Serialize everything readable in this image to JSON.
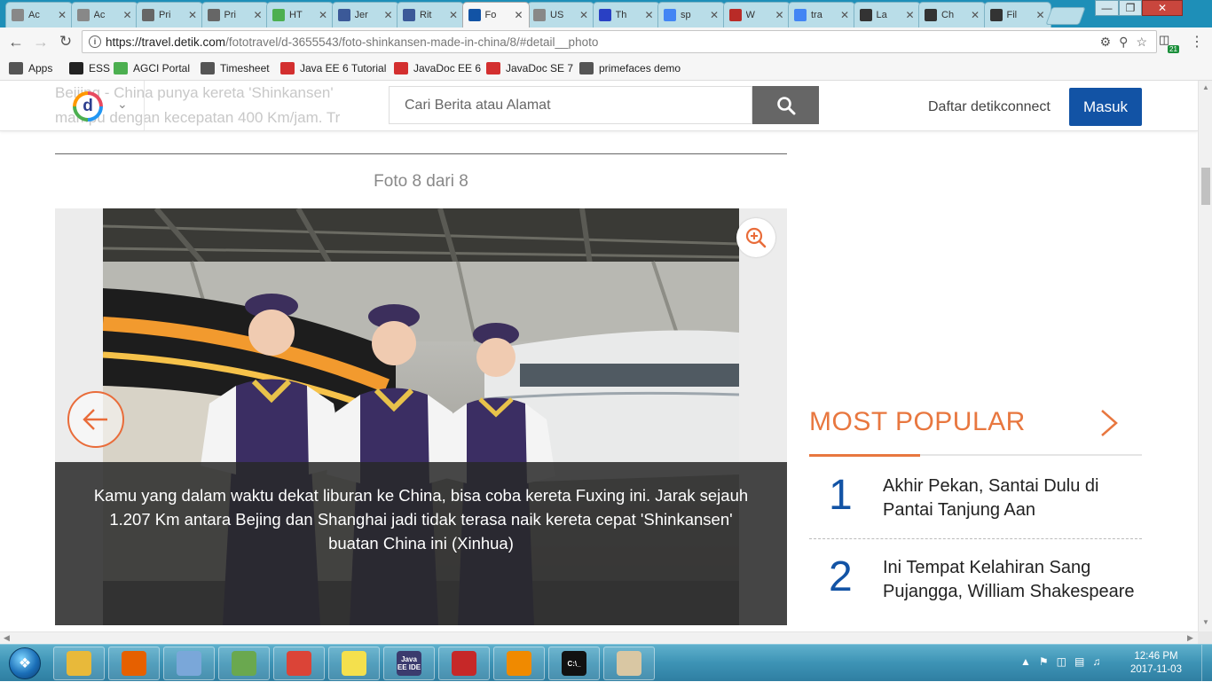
{
  "browser": {
    "tabs": [
      {
        "label": "Ac",
        "icon": "page-icon",
        "color": "#888888"
      },
      {
        "label": "Ac",
        "icon": "page-icon",
        "color": "#888888"
      },
      {
        "label": "Pri",
        "icon": "shield-icon",
        "color": "#666666"
      },
      {
        "label": "Pri",
        "icon": "shield-icon",
        "color": "#666666"
      },
      {
        "label": "HT",
        "icon": "w3-icon",
        "color": "#4caf50"
      },
      {
        "label": "Jer",
        "icon": "facebook-icon",
        "color": "#3b5998"
      },
      {
        "label": "Rit",
        "icon": "facebook-icon",
        "color": "#3b5998"
      },
      {
        "label": "Fo",
        "icon": "detik-icon",
        "color": "#1253a5"
      },
      {
        "label": "US",
        "icon": "page-icon",
        "color": "#888888"
      },
      {
        "label": "Th",
        "icon": "bold-b-icon",
        "color": "#2940c4"
      },
      {
        "label": "sp",
        "icon": "google-icon",
        "color": "#4285f4"
      },
      {
        "label": "W",
        "icon": "quora-icon",
        "color": "#b92b27"
      },
      {
        "label": "tra",
        "icon": "google-icon",
        "color": "#4285f4"
      },
      {
        "label": "La",
        "icon": "wikipedia-icon",
        "color": "#333333"
      },
      {
        "label": "Ch",
        "icon": "wikipedia-icon",
        "color": "#333333"
      },
      {
        "label": "Fil",
        "icon": "wikipedia-icon",
        "color": "#333333"
      }
    ],
    "active_tab_index": 7,
    "url_host": "https://travel.detik.com",
    "url_path": "/fototravel/d-3655543/foto-shinkansen-made-in-china/8/#detail__photo",
    "extension_badge": "21",
    "bookmarks": [
      {
        "label": "Apps",
        "icon": "apps-grid-icon",
        "color": "#555555"
      },
      {
        "label": "ESS",
        "icon": "ess-icon",
        "color": "#222222"
      },
      {
        "label": "AGCI Portal",
        "icon": "agci-icon",
        "color": "#4caf50"
      },
      {
        "label": "Timesheet",
        "icon": "calendar-icon",
        "color": "#555555"
      },
      {
        "label": "Java EE 6 Tutorial",
        "icon": "oracle-icon",
        "color": "#d32f2f"
      },
      {
        "label": "JavaDoc EE 6",
        "icon": "oracle-icon",
        "color": "#d32f2f"
      },
      {
        "label": "JavaDoc SE 7",
        "icon": "oracle-icon",
        "color": "#d32f2f"
      },
      {
        "label": "primefaces demo",
        "icon": "shield-icon",
        "color": "#555555"
      }
    ]
  },
  "site": {
    "background_text_line1": "Beijing - China punya kereta 'Shinkansen'",
    "background_text_line2": "mampu dengan kecepatan 400 Km/jam. Tr",
    "logo_letter": "d",
    "search_placeholder": "Cari Berita atau Alamat",
    "daftar_label": "Daftar detikconnect",
    "masuk_label": "Masuk",
    "accent_color": "#e8773f",
    "brand_color": "#1253a5"
  },
  "gallery": {
    "counter": "Foto 8 dari 8",
    "caption": "Kamu yang dalam waktu dekat liburan ke China, bisa coba kereta Fuxing ini. Jarak sejauh 1.207 Km antara Bejing dan Shanghai jadi tidak terasa naik kereta cepat 'Shinkansen' buatan China ini (Xinhua)"
  },
  "most_popular": {
    "title": "MOST POPULAR",
    "items": [
      {
        "rank": "1",
        "title": "Akhir Pekan, Santai Dulu di Pantai Tanjung Aan"
      },
      {
        "rank": "2",
        "title": "Ini Tempat Kelahiran Sang Pujangga, William Shakespeare"
      }
    ]
  },
  "taskbar": {
    "items": [
      {
        "name": "explorer-icon",
        "color": "#e8b93a",
        "glyph": ""
      },
      {
        "name": "firefox-icon",
        "color": "#e66000",
        "glyph": ""
      },
      {
        "name": "notepad-icon",
        "color": "#7aa7d9",
        "glyph": ""
      },
      {
        "name": "chart-editor-icon",
        "color": "#6aa84f",
        "glyph": ""
      },
      {
        "name": "chrome-icon",
        "color": "#db4437",
        "glyph": ""
      },
      {
        "name": "sticky-notes-icon",
        "color": "#f4e04d",
        "glyph": ""
      },
      {
        "name": "java-ee-ide-icon",
        "color": "#3b3b6e",
        "glyph": "Java EE IDE"
      },
      {
        "name": "pdf-reader-icon",
        "color": "#c62828",
        "glyph": ""
      },
      {
        "name": "vlc-icon",
        "color": "#f08a00",
        "glyph": ""
      },
      {
        "name": "command-prompt-icon",
        "color": "#111111",
        "glyph": "C:\\_"
      },
      {
        "name": "paint-icon",
        "color": "#d9c7a3",
        "glyph": ""
      }
    ],
    "clock_time": "12:46 PM",
    "clock_date": "2017-11-03"
  }
}
